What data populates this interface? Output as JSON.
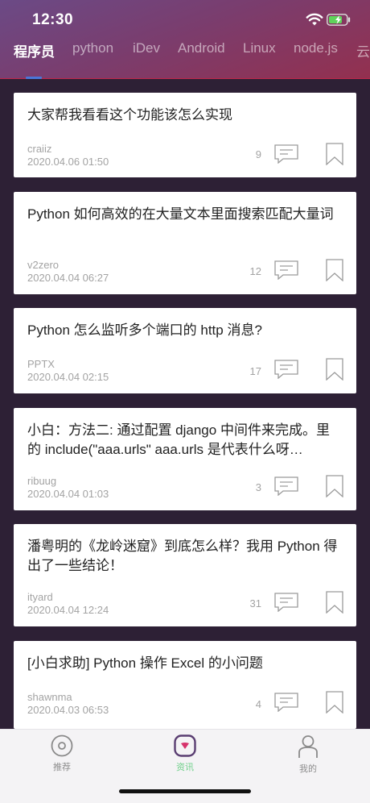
{
  "status_bar": {
    "time": "12:30"
  },
  "tabs": [
    {
      "label": "程序员",
      "active": true
    },
    {
      "label": "python",
      "active": false
    },
    {
      "label": "iDev",
      "active": false
    },
    {
      "label": "Android",
      "active": false
    },
    {
      "label": "Linux",
      "active": false
    },
    {
      "label": "node.js",
      "active": false
    },
    {
      "label": "云",
      "active": false
    }
  ],
  "posts": [
    {
      "title": "大家帮我看看这个功能该怎么实现",
      "author": "craiiz",
      "date": "2020.04.06 01:50",
      "comments": "9"
    },
    {
      "title": "Python 如何高效的在大量文本里面搜索匹配大量词",
      "author": "v2zero",
      "date": "2020.04.04 06:27",
      "comments": "12"
    },
    {
      "title": "Python 怎么监听多个端口的 http 消息?",
      "author": "PPTX",
      "date": "2020.04.04 02:15",
      "comments": "17"
    },
    {
      "title": "小白：方法二: 通过配置 django 中间件来完成。里的 include(\"aaa.urls\" aaa.urls 是代表什么呀…",
      "author": "ribuug",
      "date": "2020.04.04 01:03",
      "comments": "3"
    },
    {
      "title": "潘粤明的《龙岭迷窟》到底怎么样？我用 Python 得出了一些结论！",
      "author": "ityard",
      "date": "2020.04.04 12:24",
      "comments": "31"
    },
    {
      "title": "[小白求助] Python 操作 Excel 的小问题",
      "author": "shawnma",
      "date": "2020.04.03 06:53",
      "comments": "4"
    }
  ],
  "tabbar": {
    "items": [
      {
        "label": "推荐",
        "icon": "target-icon",
        "active": false
      },
      {
        "label": "资讯",
        "icon": "news-icon",
        "active": true
      },
      {
        "label": "我的",
        "icon": "profile-icon",
        "active": false
      }
    ]
  },
  "colors": {
    "accent": "#4a76d8",
    "tabbar_active": "#6fd08a",
    "header_start": "#6b4a86",
    "header_end": "#93304f"
  }
}
